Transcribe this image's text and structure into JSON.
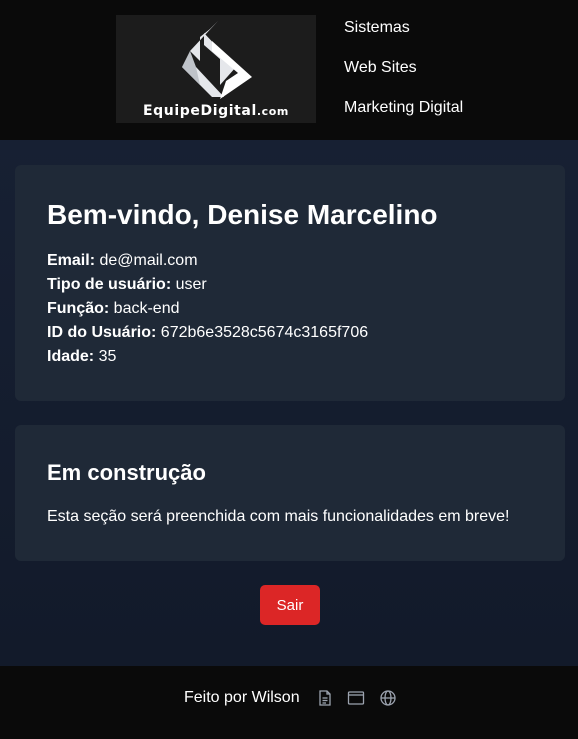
{
  "header": {
    "logo": {
      "text_main": "EquipeDigital",
      "text_suffix": ".com"
    },
    "nav": [
      {
        "label": "Sistemas"
      },
      {
        "label": "Web Sites"
      },
      {
        "label": "Marketing Digital"
      }
    ]
  },
  "profile": {
    "welcome": "Bem-vindo, Denise Marcelino",
    "fields": [
      {
        "label": "Email:",
        "value": "de@mail.com"
      },
      {
        "label": "Tipo de usuário:",
        "value": "user"
      },
      {
        "label": "Função:",
        "value": "back-end"
      },
      {
        "label": "ID do Usuário:",
        "value": "672b6e3528c5674c3165f706"
      },
      {
        "label": "Idade:",
        "value": "35"
      }
    ]
  },
  "construction": {
    "title": "Em construção",
    "text": "Esta seção será preenchida com mais funcionalidades em breve!"
  },
  "logout": {
    "label": "Sair",
    "color": "#dc2626"
  },
  "footer": {
    "credit": "Feito por Wilson",
    "icons": [
      "document-icon",
      "browser-window-icon",
      "globe-icon"
    ]
  },
  "colors": {
    "header_bg": "#0a0a0a",
    "page_bg": "#111827",
    "card_bg": "#1f2937",
    "text": "#ffffff",
    "icon": "#9ca3af"
  }
}
